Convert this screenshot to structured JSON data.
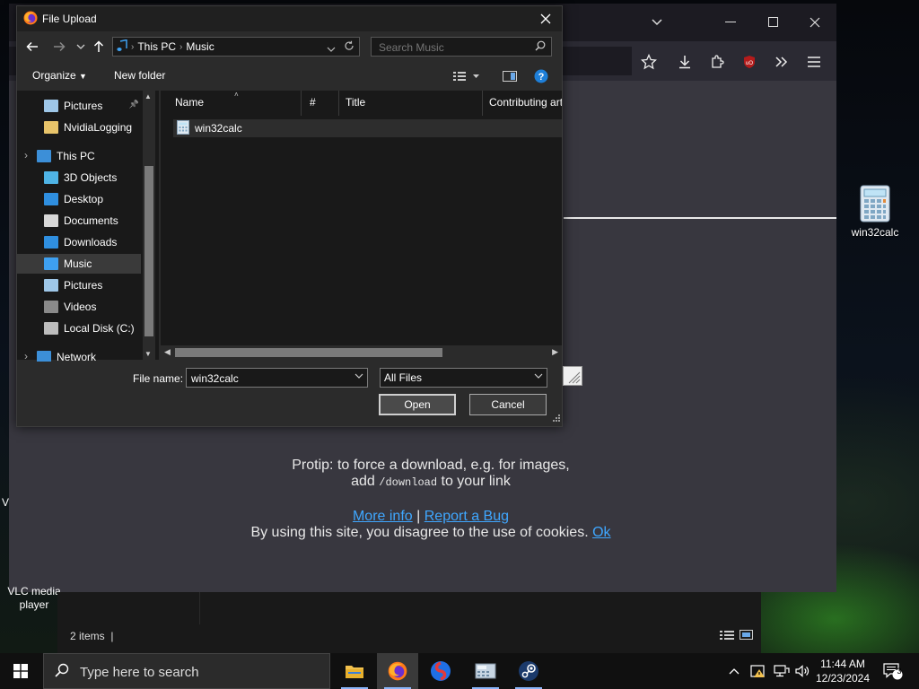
{
  "desktop": {
    "icons": [
      {
        "label": "win32calc"
      },
      {
        "label": "VLC media player"
      }
    ],
    "left_partial_char": "V"
  },
  "browser": {
    "content": {
      "protip_line1": "Protip: to force a download, e.g. for images,",
      "protip_line2_pre": "add ",
      "protip_code": "/download",
      "protip_line2_post": " to your link",
      "more_info": "More info",
      "separator": "|",
      "report_bug": "Report a Bug",
      "cookies_text": "By using this site, you disagree to the use of cookies. ",
      "ok": "Ok"
    }
  },
  "dialog": {
    "title": "File Upload",
    "address": {
      "root": "This PC",
      "folder": "Music"
    },
    "search_placeholder": "Search Music",
    "commands": {
      "organize": "Organize",
      "new_folder": "New folder"
    },
    "nav_items": [
      {
        "label": "Pictures",
        "pinned": true,
        "color": "#9ec7e8"
      },
      {
        "label": "NvidiaLogging",
        "color": "#e8c46a"
      },
      {
        "label": "This PC",
        "color": "#3c8fd8"
      },
      {
        "label": "3D Objects",
        "color": "#4fb4e6"
      },
      {
        "label": "Desktop",
        "color": "#2f8fe0"
      },
      {
        "label": "Documents",
        "color": "#d8d8d8"
      },
      {
        "label": "Downloads",
        "color": "#2f8fe0"
      },
      {
        "label": "Music",
        "color": "#3ea0f0",
        "selected": true
      },
      {
        "label": "Pictures",
        "color": "#9ec7e8"
      },
      {
        "label": "Videos",
        "color": "#8a8a8a"
      },
      {
        "label": "Local Disk (C:)",
        "color": "#bdbdbd"
      },
      {
        "label": "Network",
        "color": "#3c8fd8"
      }
    ],
    "columns": [
      "Name",
      "#",
      "Title",
      "Contributing art"
    ],
    "files": [
      {
        "name": "win32calc"
      }
    ],
    "file_name_label": "File name:",
    "file_name_value": "win32calc",
    "filter_value": "All Files",
    "open_label": "Open",
    "cancel_label": "Cancel"
  },
  "explorer_back": {
    "status": "2 items"
  },
  "taskbar": {
    "search_placeholder": "Type here to search",
    "time": "11:44 AM",
    "date": "12/23/2024",
    "notification_count": "3"
  }
}
